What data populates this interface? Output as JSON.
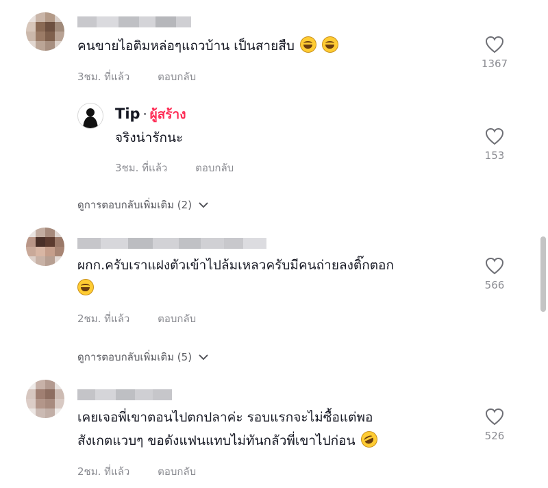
{
  "comments": [
    {
      "text": "คนขายไอติมหล่อๆแถวบ้าน เป็นสายสืบ",
      "time": "3ชม. ที่แล้ว",
      "reply": "ตอบกลับ",
      "likes": "1367",
      "emoji": [
        "laughing-emoji",
        "laughing-emoji"
      ]
    },
    {
      "text_line1": "ผกก.ครับเราแฝงตัวเข้าไปล้มเหลวครับมีคนถ่ายลงติ๊กตอก",
      "time": "2ชม. ที่แล้ว",
      "reply": "ตอบกลับ",
      "likes": "566",
      "more_replies": "ดูการตอบกลับเพิ่มเติม (5)"
    },
    {
      "text_line1": "เคยเจอพี่เขาตอนไปตกปลาค่ะ รอบแรกจะไม่ซื้อแต่พอ",
      "text_line2": "สังเกตแวบๆ ขอดังแฟนแทบไม่ทันกลัวพี่เขาไปก่อน",
      "time": "2ชม. ที่แล้ว",
      "reply": "ตอบกลับ",
      "likes": "526"
    }
  ],
  "author_reply": {
    "name": "Tip",
    "separator": "·",
    "badge": "ผู้สร้าง",
    "text": "จริงน่ารักนะ",
    "time": "3ชม. ที่แล้ว",
    "reply": "ตอบกลับ",
    "likes": "153",
    "more_replies": "ดูการตอบกลับเพิ่มเติม (2)"
  },
  "colors": {
    "creator_badge": "#fe2c55",
    "meta_text": "#8a8b91",
    "body_text": "#161823"
  },
  "icons": [
    "heart-icon",
    "chevron-down-icon",
    "laughing-emoji",
    "rofl-emoji"
  ]
}
